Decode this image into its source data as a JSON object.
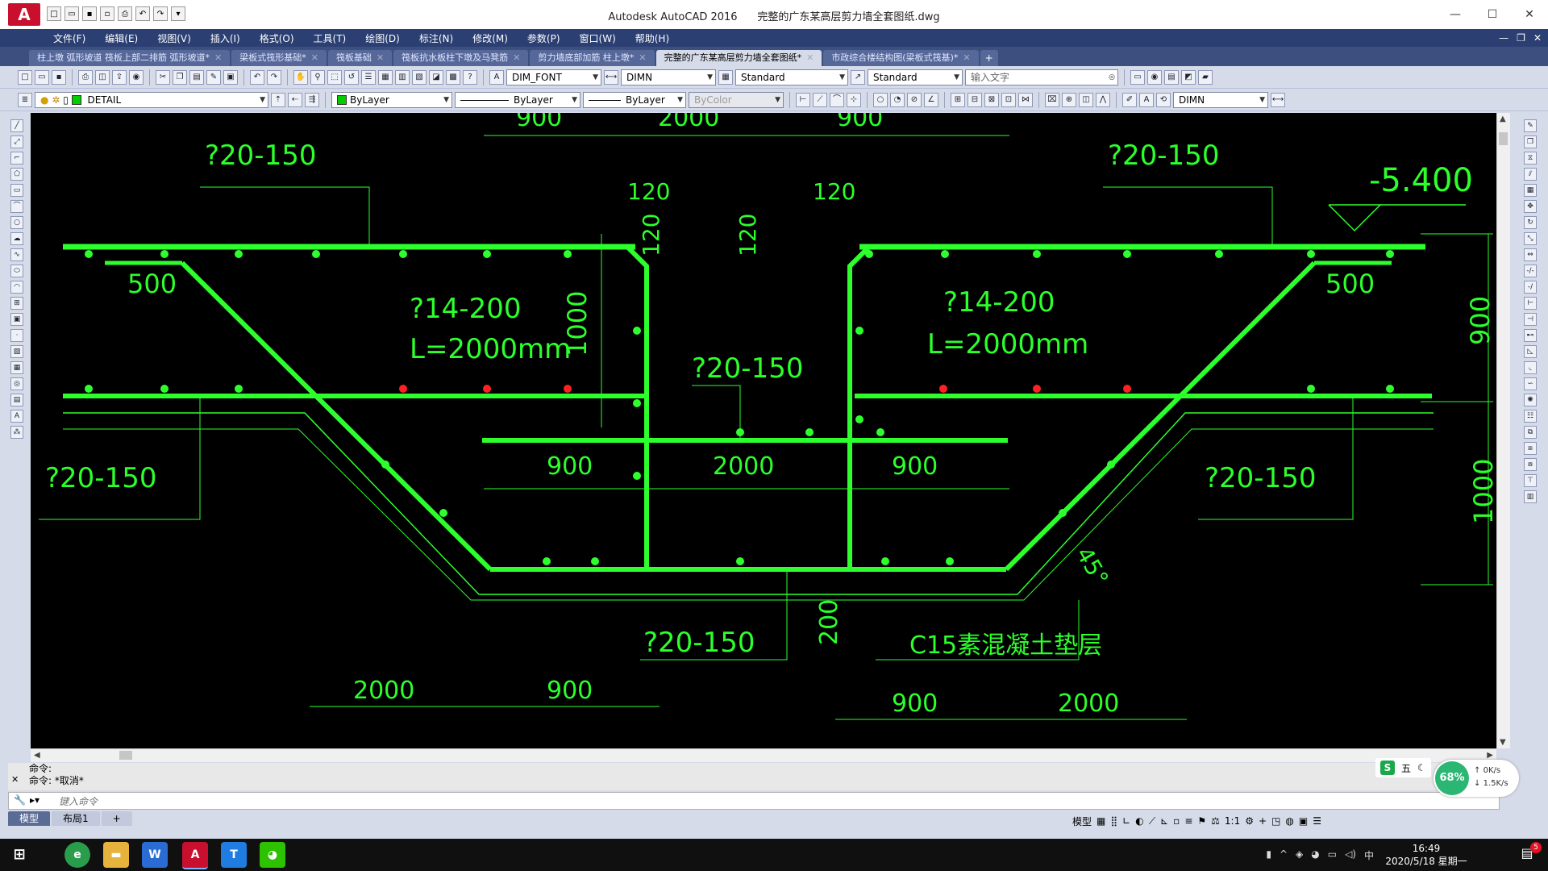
{
  "window": {
    "app_name": "Autodesk AutoCAD 2016",
    "document_name": "完整的广东某高层剪力墙全套图纸.dwg",
    "minimize": "—",
    "maximize": "☐",
    "close": "✕"
  },
  "menu": [
    "文件(F)",
    "编辑(E)",
    "视图(V)",
    "插入(I)",
    "格式(O)",
    "工具(T)",
    "绘图(D)",
    "标注(N)",
    "修改(M)",
    "参数(P)",
    "窗口(W)",
    "帮助(H)"
  ],
  "tabs": [
    {
      "label": "柱上墩 弧形坡道 筏板上部二排筋 弧形坡道*",
      "active": false
    },
    {
      "label": "梁板式筏形基础*",
      "active": false
    },
    {
      "label": "筏板基础",
      "active": false
    },
    {
      "label": "筏板抗水板柱下墩及马凳筋",
      "active": false
    },
    {
      "label": "剪力墙底部加筋 柱上墩*",
      "active": false
    },
    {
      "label": "完整的广东某高层剪力墙全套图纸*",
      "active": true
    },
    {
      "label": "市政综合楼结构图(梁板式筏基)*",
      "active": false
    }
  ],
  "toolbar1": {
    "text_style": "DIM_FONT",
    "dim_style": "DIMN",
    "table_style": "Standard",
    "multileader_style": "Standard",
    "search_placeholder": "输入文字"
  },
  "toolbar2": {
    "layer": "DETAIL",
    "color": "ByLayer",
    "linetype": "ByLayer",
    "lineweight": "ByLayer",
    "plotstyle": "ByColor",
    "dim_style": "DIMN"
  },
  "drawing": {
    "line_color": "#2cff2c",
    "rebar_dot_color": "#2cff2c",
    "red_dot_color": "#ff2020",
    "labels": [
      {
        "t": "900"
      },
      {
        "t": "2000"
      },
      {
        "t": "900"
      },
      {
        "t": "?20-150"
      },
      {
        "t": "?20-150"
      },
      {
        "t": "120"
      },
      {
        "t": "120"
      },
      {
        "t": "120"
      },
      {
        "t": "120"
      },
      {
        "t": "-5.400"
      },
      {
        "t": "500"
      },
      {
        "t": "500"
      },
      {
        "t": "?14-200"
      },
      {
        "t": "L=2000mm"
      },
      {
        "t": "?14-200"
      },
      {
        "t": "L=2000mm"
      },
      {
        "t": "1000"
      },
      {
        "t": "900"
      },
      {
        "t": "?20-150"
      },
      {
        "t": "?20-150"
      },
      {
        "t": "?20-150"
      },
      {
        "t": "900"
      },
      {
        "t": "2000"
      },
      {
        "t": "900"
      },
      {
        "t": "1000"
      },
      {
        "t": "45°"
      },
      {
        "t": "?20-150"
      },
      {
        "t": "200"
      },
      {
        "t": "C15素混凝土垫层"
      },
      {
        "t": "2000"
      },
      {
        "t": "900"
      },
      {
        "t": "900"
      },
      {
        "t": "2000"
      }
    ]
  },
  "command": {
    "history": [
      "命令:",
      "命令: *取消*"
    ],
    "placeholder": "键入命令"
  },
  "layout_tabs": [
    "模型",
    "布局1",
    "+"
  ],
  "statusbar": {
    "model": "模型",
    "scale": "1:1"
  },
  "ime": {
    "label": "五",
    "moon": "☾"
  },
  "network": {
    "percent": "68%",
    "up": "0K/s",
    "down": "1.5K/s"
  },
  "taskbar": {
    "time": "16:49",
    "date": "2020/5/18 星期一",
    "notifications": "5",
    "tray_ime": "中"
  }
}
